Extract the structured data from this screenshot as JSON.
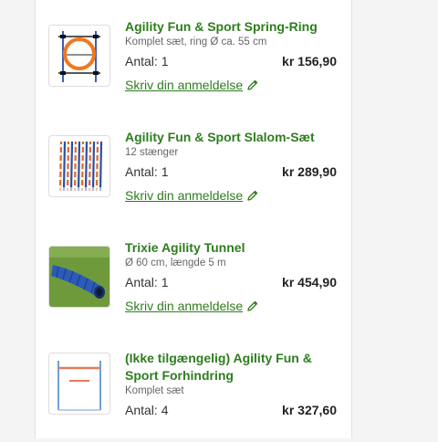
{
  "colors": {
    "accent_green": "#2e7d1e",
    "text": "#333333",
    "muted": "#666666"
  },
  "items": [
    {
      "name": "Agility Fun & Sport Spring-Ring",
      "description": "Komplet sæt, ring Ø ca. 55 cm",
      "quantity": "Antal: 1",
      "price": "kr 156,90",
      "review_link": "Skriv din anmeldelse",
      "image_icon": "agility-ring-image"
    },
    {
      "name": "Agility Fun & Sport Slalom-Sæt",
      "description": "12 stænger",
      "quantity": "Antal: 1",
      "price": "kr 289,90",
      "review_link": "Skriv din anmeldelse",
      "image_icon": "slalom-poles-image"
    },
    {
      "name": "Trixie Agility Tunnel",
      "description": "Ø 60 cm, længde 5 m",
      "quantity": "Antal: 1",
      "price": "kr 454,90",
      "review_link": "Skriv din anmeldelse",
      "image_icon": "tunnel-image"
    },
    {
      "name": "(Ikke tilgængelig) Agility Fun & Sport Forhindring",
      "description": "Komplet sæt",
      "quantity": "Antal: 4",
      "price": "kr 327,60",
      "image_icon": "hurdle-image"
    }
  ]
}
